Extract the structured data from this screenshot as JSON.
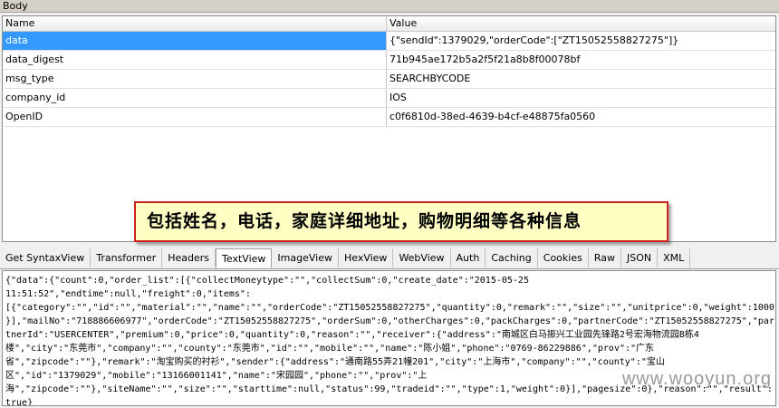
{
  "section": {
    "title": "Body"
  },
  "grid": {
    "headers": {
      "name": "Name",
      "value": "Value"
    },
    "rows": [
      {
        "name": "data",
        "value": "{\"sendId\":1379029,\"orderCode\":[\"ZT15052558827275\"]}"
      },
      {
        "name": "data_digest",
        "value": "71b945ae172b5a2f5f21a8b8f00078bf"
      },
      {
        "name": "msg_type",
        "value": "SEARCHBYCODE"
      },
      {
        "name": "company_id",
        "value": "IOS"
      },
      {
        "name": "OpenID",
        "value": "c0f6810d-38ed-4639-b4cf-e48875fa0560"
      }
    ]
  },
  "callout": {
    "text": "包括姓名，电话，家庭详细地址，购物明细等各种信息"
  },
  "tabs": [
    {
      "label": "Get SyntaxView"
    },
    {
      "label": "Transformer"
    },
    {
      "label": "Headers"
    },
    {
      "label": "TextView"
    },
    {
      "label": "ImageView"
    },
    {
      "label": "HexView"
    },
    {
      "label": "WebView"
    },
    {
      "label": "Auth"
    },
    {
      "label": "Caching"
    },
    {
      "label": "Cookies"
    },
    {
      "label": "Raw"
    },
    {
      "label": "JSON"
    },
    {
      "label": "XML"
    }
  ],
  "active_tab": "TextView",
  "textview": {
    "lines": [
      "{\"data\":{\"count\":0,\"order_list\":[{\"collectMoneytype\":\"\",\"collectSum\":0,\"create_date\":\"2015-05-25",
      "11:51:52\",\"endtime\":null,\"freight\":0,\"items\":",
      "[{\"category\":\"\",\"id\":\"\",\"material\":\"\",\"name\":\"\",\"orderCode\":\"ZT15052558827275\",\"quantity\":0,\"remark\":\"\",\"size\":\"\",\"unitprice\":0,\"weight\":1000",
      "}],\"mailNo\":\"718886606977\",\"orderCode\":\"ZT15052558827275\",\"orderSum\":0,\"otherCharges\":0,\"packCharges\":0,\"partnerCode\":\"ZT15052558827275\",\"par",
      "tnerId\":\"USERCENTER\",\"premium\":0,\"price\":0,\"quantity\":0,\"reason\":\"\",\"receiver\":{\"address\":\"南城区白马振兴工业园先锋路2号宏海物流园B栋4",
      "楼\",\"city\":\"东莞市\",\"company\":\"\",\"county\":\"东莞市\",\"id\":\"\",\"mobile\":\"\",\"name\":\"陈小姐\",\"phone\":\"0769-86229886\",\"prov\":\"广东",
      "省\",\"zipcode\":\"\"},\"remark\":\"淘宝购买的衬衫\",\"sender\":{\"address\":\"通南路55弄21幢201\",\"city\":\"上海市\",\"company\":\"\",\"county\":\"宝山",
      "区\",\"id\":\"1379029\",\"mobile\":\"13166001141\",\"name\":\"宋园园\",\"phone\":\"\",\"prov\":\"上",
      "海\",\"zipcode\":\"\"},\"siteName\":\"\",\"size\":\"\",\"starttime\":null,\"status\":99,\"tradeid\":\"\",\"type\":1,\"weight\":0}],\"pagesize\":0},\"reason\":\"\",\"result\":",
      "true}"
    ]
  },
  "watermark": "www.wooyun.org"
}
